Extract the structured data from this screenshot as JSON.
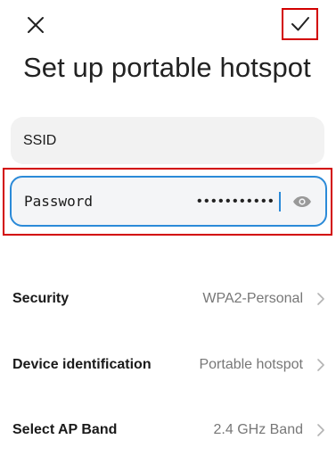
{
  "header": {
    "close_icon": "close-icon",
    "confirm_icon": "check-icon",
    "title": "Set up portable hotspot"
  },
  "form": {
    "ssid": {
      "label": "SSID"
    },
    "password": {
      "label": "Password",
      "masked_value": "•••••••••••",
      "visibility_icon": "eye-icon"
    }
  },
  "settings": [
    {
      "label": "Security",
      "value": "WPA2-Personal"
    },
    {
      "label": "Device identification",
      "value": "Portable hotspot"
    },
    {
      "label": "Select AP Band",
      "value": "2.4 GHz Band"
    }
  ],
  "colors": {
    "accent": "#2b8ad8",
    "highlight": "#d20000",
    "field_background": "#f2f2f2",
    "secondary_text": "#777777"
  }
}
